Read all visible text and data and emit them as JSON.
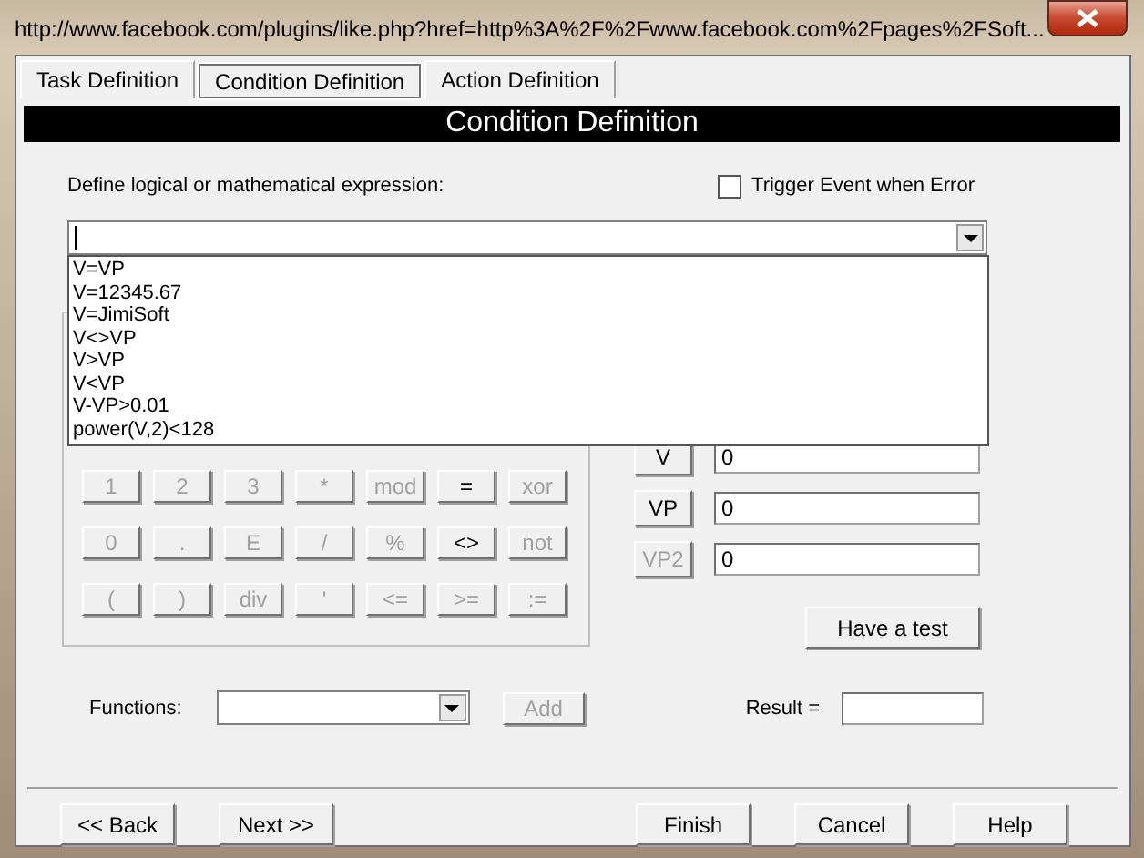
{
  "window": {
    "title": "http://www.facebook.com/plugins/like.php?href=http%3A%2F%2Fwww.facebook.com%2Fpages%2FSoft..."
  },
  "tabs": [
    {
      "label": "Task Definition",
      "selected": false
    },
    {
      "label": "Condition Definition",
      "selected": true
    },
    {
      "label": "Action Definition",
      "selected": false
    }
  ],
  "banner": "Condition Definition",
  "expression": {
    "label": "Define logical or mathematical expression:",
    "expanded": true,
    "options": [
      "V=VP",
      "V=12345.67",
      "V=JimiSoft",
      "V<>VP",
      "V>VP",
      "V<VP",
      "V-VP>0.01",
      "power(V,2)<128"
    ]
  },
  "trigger_error": {
    "label": "Trigger Event when Error",
    "checked": false
  },
  "keypad": [
    [
      {
        "label": "1",
        "disabled": true
      },
      {
        "label": "2",
        "disabled": true
      },
      {
        "label": "3",
        "disabled": true
      },
      {
        "label": "*",
        "disabled": true
      },
      {
        "label": "mod",
        "disabled": true
      },
      {
        "label": "=",
        "disabled": false
      },
      {
        "label": "xor",
        "disabled": true
      }
    ],
    [
      {
        "label": "0",
        "disabled": true
      },
      {
        "label": ".",
        "disabled": true
      },
      {
        "label": "E",
        "disabled": true
      },
      {
        "label": "/",
        "disabled": true
      },
      {
        "label": "%",
        "disabled": true
      },
      {
        "label": "<>",
        "disabled": false
      },
      {
        "label": "not",
        "disabled": true
      }
    ],
    [
      {
        "label": "(",
        "disabled": true
      },
      {
        "label": ")",
        "disabled": true
      },
      {
        "label": "div",
        "disabled": true
      },
      {
        "label": "'",
        "disabled": true
      },
      {
        "label": "<=",
        "disabled": true
      },
      {
        "label": ">=",
        "disabled": true
      },
      {
        "label": ":=",
        "disabled": true
      }
    ]
  ],
  "variables": [
    {
      "button": "V",
      "value": "0",
      "disabled": false
    },
    {
      "button": "VP",
      "value": "0",
      "disabled": false
    },
    {
      "button": "VP2",
      "value": "0",
      "disabled": true
    }
  ],
  "test_button": "Have a test",
  "functions": {
    "label": "Functions:",
    "add_button": {
      "label": "Add",
      "disabled": true
    }
  },
  "result": {
    "label": "Result ="
  },
  "nav_buttons": [
    "<< Back",
    "Next >>",
    "Finish",
    "Cancel",
    "Help"
  ]
}
